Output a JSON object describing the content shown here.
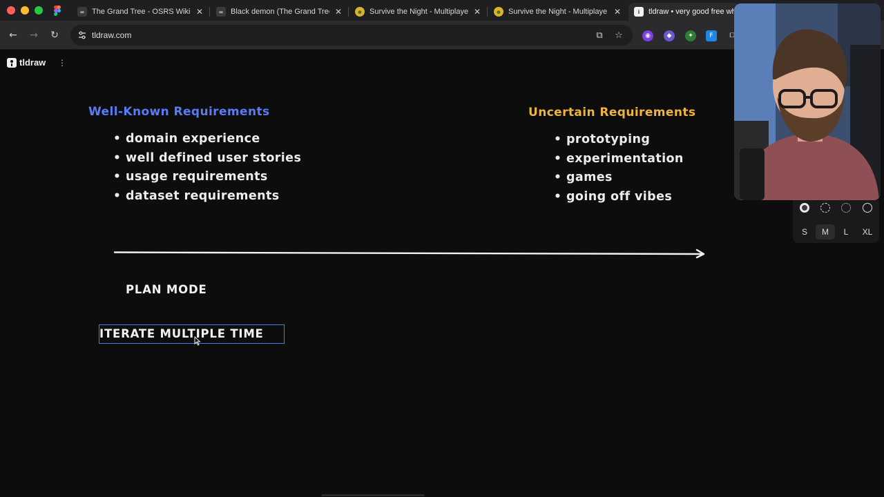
{
  "browser": {
    "tabs": [
      {
        "title": "The Grand Tree - OSRS Wiki",
        "favicon": "wiki-favicon-icon",
        "active": false
      },
      {
        "title": "Black demon (The Grand Tree",
        "favicon": "wiki-favicon-icon",
        "active": false
      },
      {
        "title": "Survive the Night - Multiplaye",
        "favicon": "game-favicon-icon",
        "active": false
      },
      {
        "title": "Survive the Night - Multiplaye",
        "favicon": "game-favicon-icon",
        "active": false
      },
      {
        "title": "tldraw • very good free whi",
        "favicon": "tldraw-favicon-icon",
        "active": true
      }
    ],
    "url": "tldraw.com",
    "colors": {
      "tab_bar": "#1f1f21",
      "toolbar": "#2b2b2d",
      "omnibox": "#1e1e20"
    }
  },
  "app": {
    "brand": "tldraw",
    "colors": {
      "canvas": "#0d0d0e",
      "blue": "#5b7bf0",
      "orange": "#f0b43c",
      "selection": "#4c7be8"
    }
  },
  "canvas": {
    "left_heading": "Well-Known Requirements",
    "left_items": [
      "domain experience",
      "well defined user stories",
      "usage requirements",
      "dataset requirements"
    ],
    "right_heading": "Uncertain Requirements",
    "right_items": [
      "prototyping",
      "experimentation",
      "games",
      "going off vibes"
    ],
    "bullet": "•",
    "plan_mode": "PLAN MODE",
    "iterate": "ITERATE MULTIPLE TIME"
  },
  "style_panel": {
    "dash_styles": [
      "solid",
      "dashed",
      "dotted",
      "draw"
    ],
    "selected_dash": "solid",
    "sizes": [
      "S",
      "M",
      "L",
      "XL"
    ],
    "selected_size": "M"
  }
}
